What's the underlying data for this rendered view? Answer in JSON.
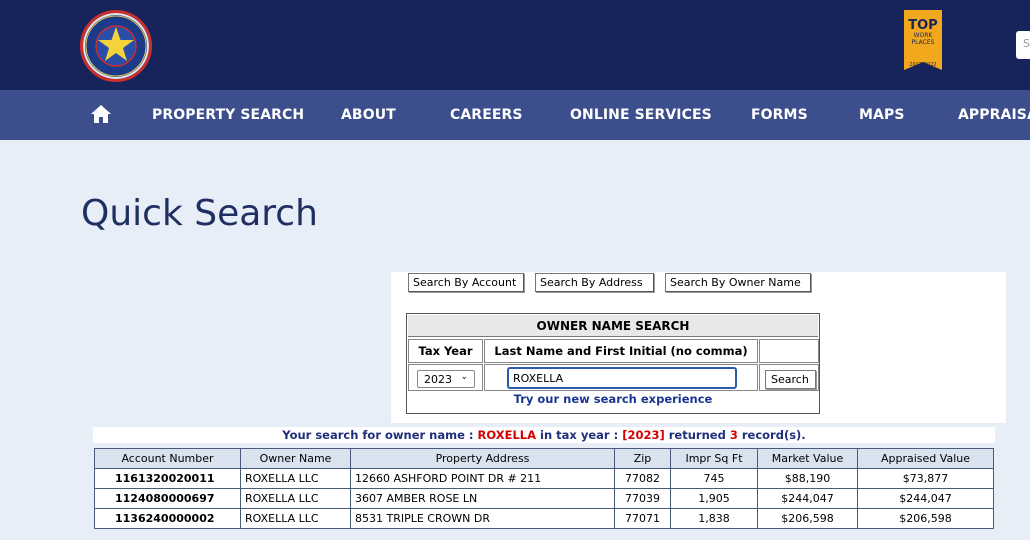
{
  "header": {
    "logo_text": "HARRIS CENTRAL APPRAISAL DISTRICT Texas",
    "badge": {
      "title": "TOP",
      "line1": "WORK",
      "line2": "PLACES",
      "years": "2017-2022"
    },
    "search_placeholder": "S"
  },
  "nav": {
    "items": [
      {
        "label": "PROPERTY SEARCH"
      },
      {
        "label": "ABOUT"
      },
      {
        "label": "CAREERS"
      },
      {
        "label": "ONLINE SERVICES"
      },
      {
        "label": "FORMS"
      },
      {
        "label": "MAPS"
      },
      {
        "label": "APPRAISAL"
      }
    ]
  },
  "page": {
    "title": "Quick Search"
  },
  "search_tabs": {
    "account": "Search By Account",
    "address": "Search By Address",
    "owner": "Search By Owner Name"
  },
  "owner_search": {
    "title": "OWNER NAME SEARCH",
    "tax_year_label": "Tax Year",
    "name_label": "Last Name and First Initial (no comma)",
    "tax_year_value": "2023",
    "name_value": "ROXELLA",
    "search_button": "Search",
    "new_experience_link": "Try our new search experience"
  },
  "result_summary": {
    "prefix": "Your search for owner name :",
    "owner": "ROXELLA",
    "mid": "in tax year :",
    "year": "[2023]",
    "returned": "returned",
    "count": "3",
    "suffix": "record(s)."
  },
  "results": {
    "columns": [
      "Account Number",
      "Owner Name",
      "Property Address",
      "Zip",
      "Impr Sq Ft",
      "Market Value",
      "Appraised Value"
    ],
    "rows": [
      {
        "account": "1161320020011",
        "owner": "ROXELLA LLC",
        "address": "12660 ASHFORD POINT DR # 211",
        "zip": "77082",
        "sqft": "745",
        "market": "$88,190",
        "appraised": "$73,877"
      },
      {
        "account": "1124080000697",
        "owner": "ROXELLA LLC",
        "address": "3607 AMBER ROSE LN",
        "zip": "77039",
        "sqft": "1,905",
        "market": "$244,047",
        "appraised": "$244,047"
      },
      {
        "account": "1136240000002",
        "owner": "ROXELLA LLC",
        "address": "8531 TRIPLE CROWN DR",
        "zip": "77071",
        "sqft": "1,838",
        "market": "$206,598",
        "appraised": "$206,598"
      }
    ]
  }
}
